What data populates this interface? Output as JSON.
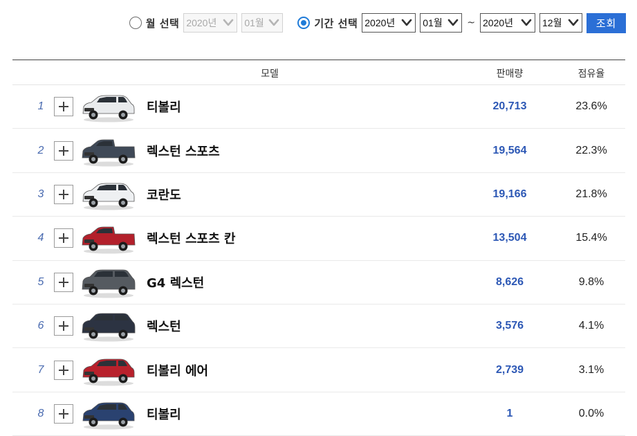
{
  "filter": {
    "month_option": {
      "label": "월 선택",
      "checked": false,
      "year": "2020년",
      "month": "01월"
    },
    "period_option": {
      "label": "기간 선택",
      "checked": true,
      "start_year": "2020년",
      "start_month": "01월",
      "separator": "~",
      "end_year": "2020년",
      "end_month": "12월"
    },
    "search_label": "조회",
    "accent_color": "#2b6fd6"
  },
  "table": {
    "headers": {
      "model": "모델",
      "sales": "판매량",
      "share": "점유율"
    },
    "rows": [
      {
        "rank": "1",
        "name": "티볼리",
        "sales": "20,713",
        "share": "23.6%",
        "car_color": "#e9ebed",
        "car_shape": "compact-suv"
      },
      {
        "rank": "2",
        "name": "렉스턴 스포츠",
        "sales": "19,564",
        "share": "22.3%",
        "car_color": "#3f4957",
        "car_shape": "pickup"
      },
      {
        "rank": "3",
        "name": "코란도",
        "sales": "19,166",
        "share": "21.8%",
        "car_color": "#eef0f2",
        "car_shape": "compact-suv"
      },
      {
        "rank": "4",
        "name": "렉스턴 스포츠 칸",
        "sales": "13,504",
        "share": "15.4%",
        "car_color": "#b3202b",
        "car_shape": "pickup"
      },
      {
        "rank": "5",
        "name": "G4 렉스턴",
        "sales": "8,626",
        "share": "9.8%",
        "car_color": "#555a60",
        "car_shape": "large-suv"
      },
      {
        "rank": "6",
        "name": "렉스턴",
        "sales": "3,576",
        "share": "4.1%",
        "car_color": "#2c3342",
        "car_shape": "large-suv"
      },
      {
        "rank": "7",
        "name": "티볼리 에어",
        "sales": "2,739",
        "share": "3.1%",
        "car_color": "#b8212c",
        "car_shape": "compact-suv"
      },
      {
        "rank": "8",
        "name": "티볼리",
        "sales": "1",
        "share": "0.0%",
        "car_color": "#2a4270",
        "car_shape": "compact-suv"
      }
    ]
  }
}
